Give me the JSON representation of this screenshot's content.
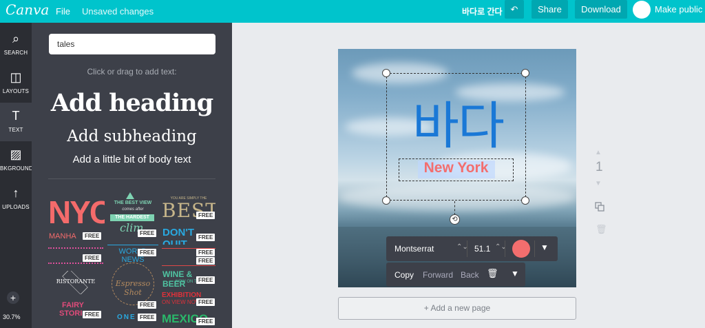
{
  "topbar": {
    "logo": "Canva",
    "file_label": "File",
    "unsaved_label": "Unsaved changes",
    "doc_title": "바다로 간다",
    "undo_icon": "↶",
    "share_label": "Share",
    "download_label": "Download",
    "make_public_label": "Make public"
  },
  "leftnav": {
    "items": [
      {
        "icon": "⌕",
        "label": "SEARCH"
      },
      {
        "icon": "◫",
        "label": "LAYOUTS"
      },
      {
        "icon": "T",
        "label": "TEXT"
      },
      {
        "icon": "▨",
        "label": "BKGROUND"
      },
      {
        "icon": "↑",
        "label": "UPLOADS"
      }
    ],
    "plus_icon": "+",
    "zoom": "30.7%"
  },
  "panel": {
    "search_value": "tales",
    "hint": "Click or drag to add text:",
    "add_heading": "Add heading",
    "add_subheading": "Add subheading",
    "add_body": "Add a little bit of body text",
    "free_badge": "FREE",
    "tiles": {
      "nyc": "NYC",
      "manhattan": "MANHA",
      "best_view": "THE BEST VIEW",
      "comes_after": "comes after",
      "the_hardest": "THE HARDEST",
      "climb": "clim",
      "best": "BEST",
      "you_are_simply": "YOU ARE SIMPLY THE",
      "dont_quit": "DON'T QUIT",
      "world_news": "WORLD NEWS",
      "ristorante": "RISTORANTE",
      "espresso_shot": "Espresso Shot",
      "wine_beer": "WINE & BEER",
      "now_on_tap": "NOW ON TAP",
      "fairy": "FAIRY",
      "stories": "STORI",
      "exhibition": "EXHIBITION",
      "on_view": "ON VIEW NOW",
      "mexico": "MEXICO",
      "one": "ONE D"
    }
  },
  "canvas": {
    "main_text": "바다",
    "sub_text": "New York",
    "rotate_icon": "⟲"
  },
  "text_toolbar": {
    "font": "Montserrat",
    "size": "51.1",
    "color": "#f36e6e",
    "chevron_icon": "▼",
    "spinner_icon": "⌃⌄"
  },
  "action_toolbar": {
    "copy": "Copy",
    "forward": "Forward",
    "back": "Back",
    "trash_icon": "🗑",
    "chevron_icon": "▼"
  },
  "page_controls": {
    "up_icon": "▲",
    "page_number": "1",
    "down_icon": "▼",
    "duplicate_icon": "⧉",
    "delete_icon": "🗑"
  },
  "add_page_label": "+ Add a new page",
  "colors": {
    "brand": "#00c4cc",
    "brand_dark": "#00a7b1",
    "nav_bg": "#2b2d33",
    "panel_bg": "#3d4049",
    "main_text": "#1a78d6",
    "accent_text": "#f36e6e"
  }
}
